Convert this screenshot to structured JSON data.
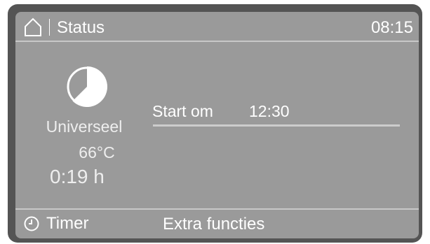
{
  "header": {
    "title": "Status",
    "time": "08:15",
    "home_icon": "home-icon"
  },
  "program": {
    "icon": "pie-progress-icon",
    "name": "Universeel",
    "temperature": "66°C",
    "duration": "0:19 h"
  },
  "start": {
    "label": "Start om",
    "time": "12:30"
  },
  "footer": {
    "timer_icon": "clock-icon",
    "timer_label": "Timer",
    "extra_label": "Extra functies"
  },
  "colors": {
    "bezel": "#545454",
    "screen": "#9a9a9a",
    "text": "#ffffff",
    "divider": "#c8c8c8"
  }
}
